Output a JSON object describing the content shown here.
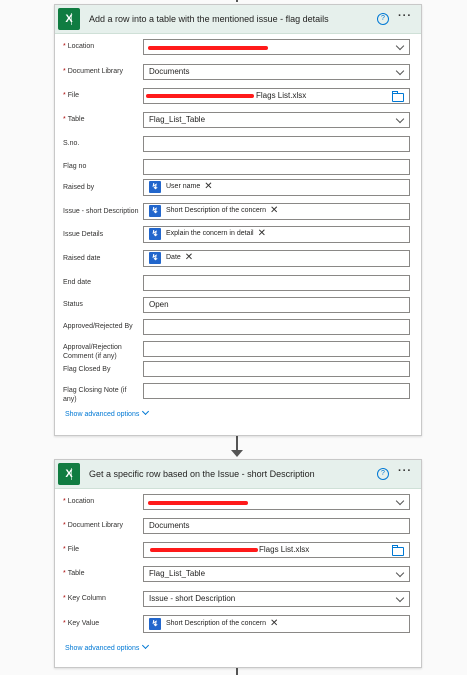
{
  "card1": {
    "title": "Add a row into a table with the mentioned issue - flag details",
    "help": "?",
    "more": "···",
    "fields": {
      "location": {
        "label": "Location",
        "value": ""
      },
      "library": {
        "label": "Document Library",
        "value": "Documents"
      },
      "file": {
        "label": "File",
        "value": "Flags List.xlsx"
      },
      "table": {
        "label": "Table",
        "value": "Flag_List_Table"
      },
      "sno": {
        "label": "S.no.",
        "value": ""
      },
      "flagno": {
        "label": "Flag no",
        "value": ""
      },
      "raisedby": {
        "label": "Raised by",
        "token": "User name"
      },
      "issue": {
        "label": "Issue - short Description",
        "token": "Short Description of the concern"
      },
      "details": {
        "label": "Issue Details",
        "token": "Explain the concern in detail"
      },
      "raiseddate": {
        "label": "Raised date",
        "token": "Date"
      },
      "enddate": {
        "label": "End date",
        "value": ""
      },
      "status": {
        "label": "Status",
        "value": "Open"
      },
      "approvedby": {
        "label": "Approved/Rejected By",
        "value": ""
      },
      "comment": {
        "label": "Approval/Rejection Comment (if any)",
        "value": ""
      },
      "closedby": {
        "label": "Flag Closed By",
        "value": ""
      },
      "closingnote": {
        "label": "Flag Closing Note (if any)",
        "value": ""
      }
    },
    "advanced": "Show advanced options"
  },
  "card2": {
    "title": "Get a specific row based on the Issue - short Description",
    "help": "?",
    "more": "···",
    "fields": {
      "location": {
        "label": "Location",
        "value": ""
      },
      "library": {
        "label": "Document Library",
        "value": "Documents"
      },
      "file": {
        "label": "File",
        "value": "Flags List.xlsx"
      },
      "table": {
        "label": "Table",
        "value": "Flag_List_Table"
      },
      "keycolumn": {
        "label": "Key Column",
        "value": "Issue - short Description"
      },
      "keyvalue": {
        "label": "Key Value",
        "token": "Short Description of the concern"
      }
    },
    "advanced": "Show advanced options"
  },
  "required_marker": "*",
  "token_remove": "✕",
  "colors": {
    "accent": "#0078d4",
    "excel": "#107c41",
    "header_bg": "#e6f0ec",
    "redaction": "#ff1a1a"
  }
}
